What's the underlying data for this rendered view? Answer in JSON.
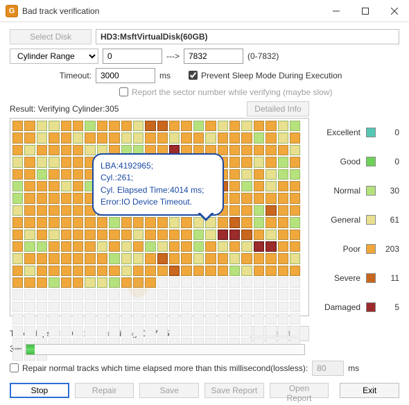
{
  "window": {
    "title": "Bad track verification",
    "icon_letter": "G"
  },
  "toolbar": {
    "select_disk": "Select Disk",
    "disk_label": "HD3:MsftVirtualDisk(60GB)"
  },
  "range": {
    "mode": "Cylinder Range",
    "from": "0",
    "arrow": "--->",
    "to": "7832",
    "hint": "(0-7832)"
  },
  "timeout": {
    "label": "Timeout:",
    "value": "3000",
    "unit": "ms"
  },
  "options": {
    "prevent_sleep": "Prevent Sleep Mode During Execution",
    "report_sector": "Report the sector number while verifying (maybe slow)"
  },
  "status": {
    "result_prefix": "Result:",
    "verifying": "Verifying Cylinder:305",
    "detailed_btn": "Detailed Info"
  },
  "tooltip": {
    "l1": "LBA:4192965;",
    "l2": "Cyl.:261;",
    "l3": "Cyl. Elapsed Time:4014 ms;",
    "l4": "Error:IO Device Timeout."
  },
  "legend": [
    {
      "name": "Excellent",
      "color": "#56c6b4",
      "count": 0
    },
    {
      "name": "Good",
      "color": "#6ed15a",
      "count": 0
    },
    {
      "name": "Normal",
      "color": "#b5e27d",
      "count": 30
    },
    {
      "name": "General",
      "color": "#e8df8f",
      "count": 61
    },
    {
      "name": "Poor",
      "color": "#f0a83c",
      "count": 203
    },
    {
      "name": "Severe",
      "color": "#c9671e",
      "count": 11
    },
    {
      "name": "Damaged",
      "color": "#9c2b2b",
      "count": 5
    }
  ],
  "grid": {
    "cols": 27,
    "rows": 17,
    "filled_rows": 12
  },
  "time": {
    "elapsed_label": "Time Elapsed:",
    "elapsed": "0:00:18",
    "remaining_label": "Remaining:",
    "remaining": "0:07:55",
    "reset": "Reset",
    "percent_text": "3%",
    "percent_num": 3
  },
  "repair": {
    "label": "Repair normal tracks which time elapsed more than this millisecond(lossless):",
    "value": "80",
    "unit": "ms"
  },
  "buttons": {
    "stop": "Stop",
    "repair": "Repair",
    "save": "Save",
    "save_report": "Save Report",
    "open_report": "Open Report",
    "exit": "Exit"
  }
}
